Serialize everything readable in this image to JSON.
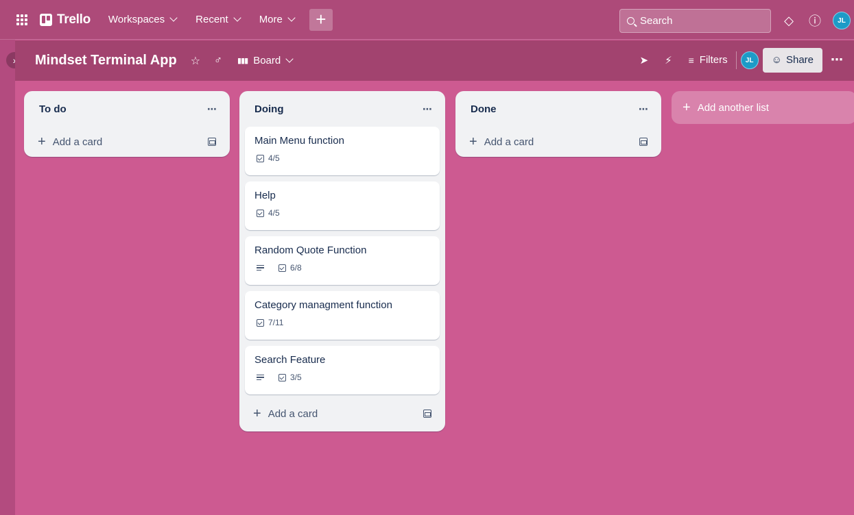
{
  "topnav": {
    "logo_text": "Trello",
    "menu": [
      {
        "label": "Workspaces"
      },
      {
        "label": "Recent"
      },
      {
        "label": "More"
      }
    ],
    "create_label": "+",
    "search_placeholder": "Search",
    "avatar_initials": "JL"
  },
  "board": {
    "title": "Mindset Terminal App",
    "view_label": "Board",
    "filters_label": "Filters",
    "share_label": "Share",
    "avatar_initials": "JL"
  },
  "lists": [
    {
      "title": "To do",
      "add_card_label": "Add a card",
      "cards": []
    },
    {
      "title": "Doing",
      "add_card_label": "Add a card",
      "cards": [
        {
          "title": "Main Menu function",
          "has_description": false,
          "checklist": "4/5"
        },
        {
          "title": "Help",
          "has_description": false,
          "checklist": "4/5"
        },
        {
          "title": "Random Quote Function",
          "has_description": true,
          "checklist": "6/8"
        },
        {
          "title": "Category managment function",
          "has_description": false,
          "checklist": "7/11"
        },
        {
          "title": "Search Feature",
          "has_description": true,
          "checklist": "3/5"
        }
      ]
    },
    {
      "title": "Done",
      "add_card_label": "Add a card",
      "cards": []
    }
  ],
  "add_list_label": "Add another list",
  "colors": {
    "board_background": "#cd5a91",
    "topnav": "#ad4a79",
    "board_header": "#a2436f",
    "list_background": "#f1f2f4",
    "avatar": "#1d9bc7"
  }
}
